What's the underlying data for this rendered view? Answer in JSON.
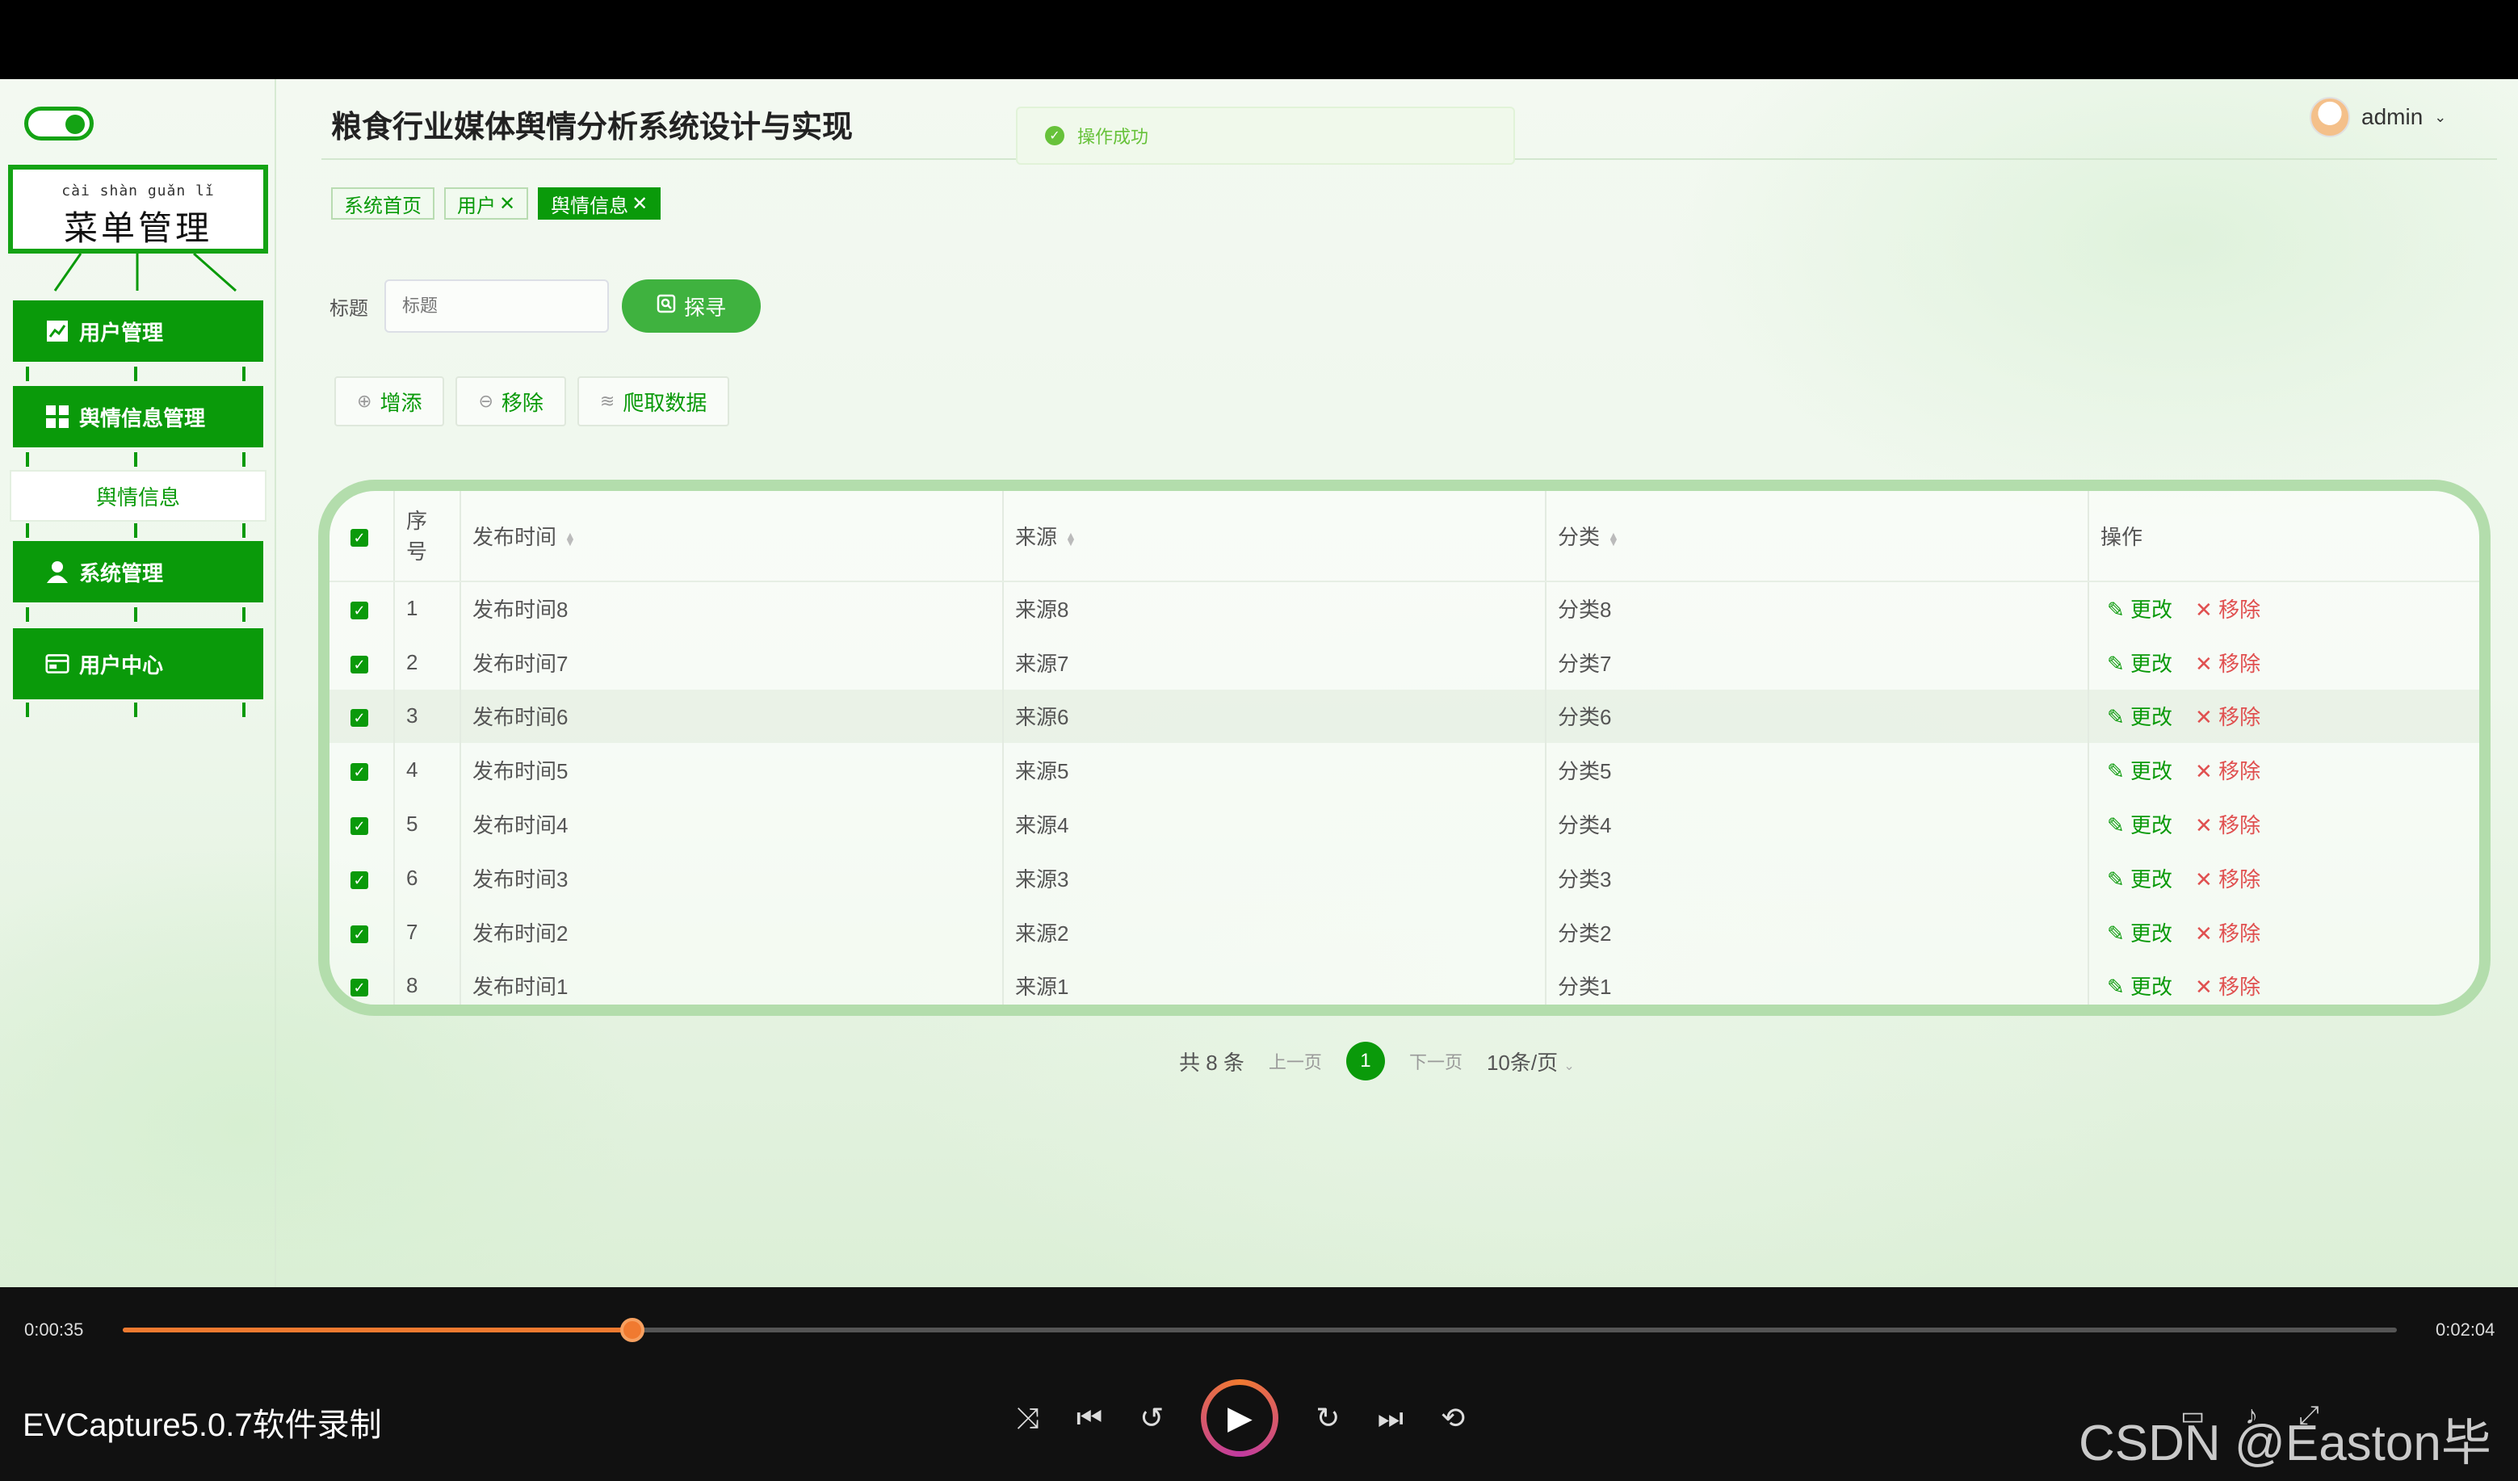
{
  "app": {
    "title": "粮食行业媒体舆情分析系统设计与实现",
    "user": "admin"
  },
  "toast": {
    "message": "操作成功"
  },
  "sidebar": {
    "menu_pinyin": "cài shàn guǎn lǐ",
    "menu_title": "菜单管理",
    "items": [
      {
        "label": "用户管理",
        "icon": "chart-icon"
      },
      {
        "label": "舆情信息管理",
        "icon": "grid-icon"
      },
      {
        "label": "舆情信息",
        "icon": ""
      },
      {
        "label": "系统管理",
        "icon": "person-icon"
      },
      {
        "label": "用户中心",
        "icon": "card-icon"
      }
    ]
  },
  "tabs": [
    {
      "label": "系统首页",
      "closable": false,
      "active": false
    },
    {
      "label": "用户",
      "closable": true,
      "active": false
    },
    {
      "label": "舆情信息",
      "closable": true,
      "active": true
    }
  ],
  "search": {
    "label": "标题",
    "placeholder": "标题",
    "button": "探寻"
  },
  "actions": {
    "add": "增添",
    "remove": "移除",
    "crawl": "爬取数据"
  },
  "table": {
    "headers": {
      "index": "序号",
      "time": "发布时间",
      "source": "来源",
      "category": "分类",
      "ops": "操作"
    },
    "rows": [
      {
        "index": "1",
        "time": "发布时间8",
        "source": "来源8",
        "category": "分类8"
      },
      {
        "index": "2",
        "time": "发布时间7",
        "source": "来源7",
        "category": "分类7"
      },
      {
        "index": "3",
        "time": "发布时间6",
        "source": "来源6",
        "category": "分类6"
      },
      {
        "index": "4",
        "time": "发布时间5",
        "source": "来源5",
        "category": "分类5"
      },
      {
        "index": "5",
        "time": "发布时间4",
        "source": "来源4",
        "category": "分类4"
      },
      {
        "index": "6",
        "time": "发布时间3",
        "source": "来源3",
        "category": "分类3"
      },
      {
        "index": "7",
        "time": "发布时间2",
        "source": "来源2",
        "category": "分类2"
      },
      {
        "index": "8",
        "time": "发布时间1",
        "source": "来源1",
        "category": "分类1"
      }
    ],
    "edit_label": "更改",
    "delete_label": "移除"
  },
  "pagination": {
    "total": "共 8 条",
    "prev": "上一页",
    "current": "1",
    "next": "下一页",
    "page_size": "10条/页"
  },
  "player": {
    "current_time": "0:00:35",
    "total_time": "0:02:04",
    "progress": 0.224,
    "label": "EVCapture5.0.7软件录制",
    "watermark": "CSDN @Easton毕设"
  },
  "colors": {
    "primary": "#0a9a0a",
    "danger": "#e05050",
    "progress": "#f07a30"
  }
}
